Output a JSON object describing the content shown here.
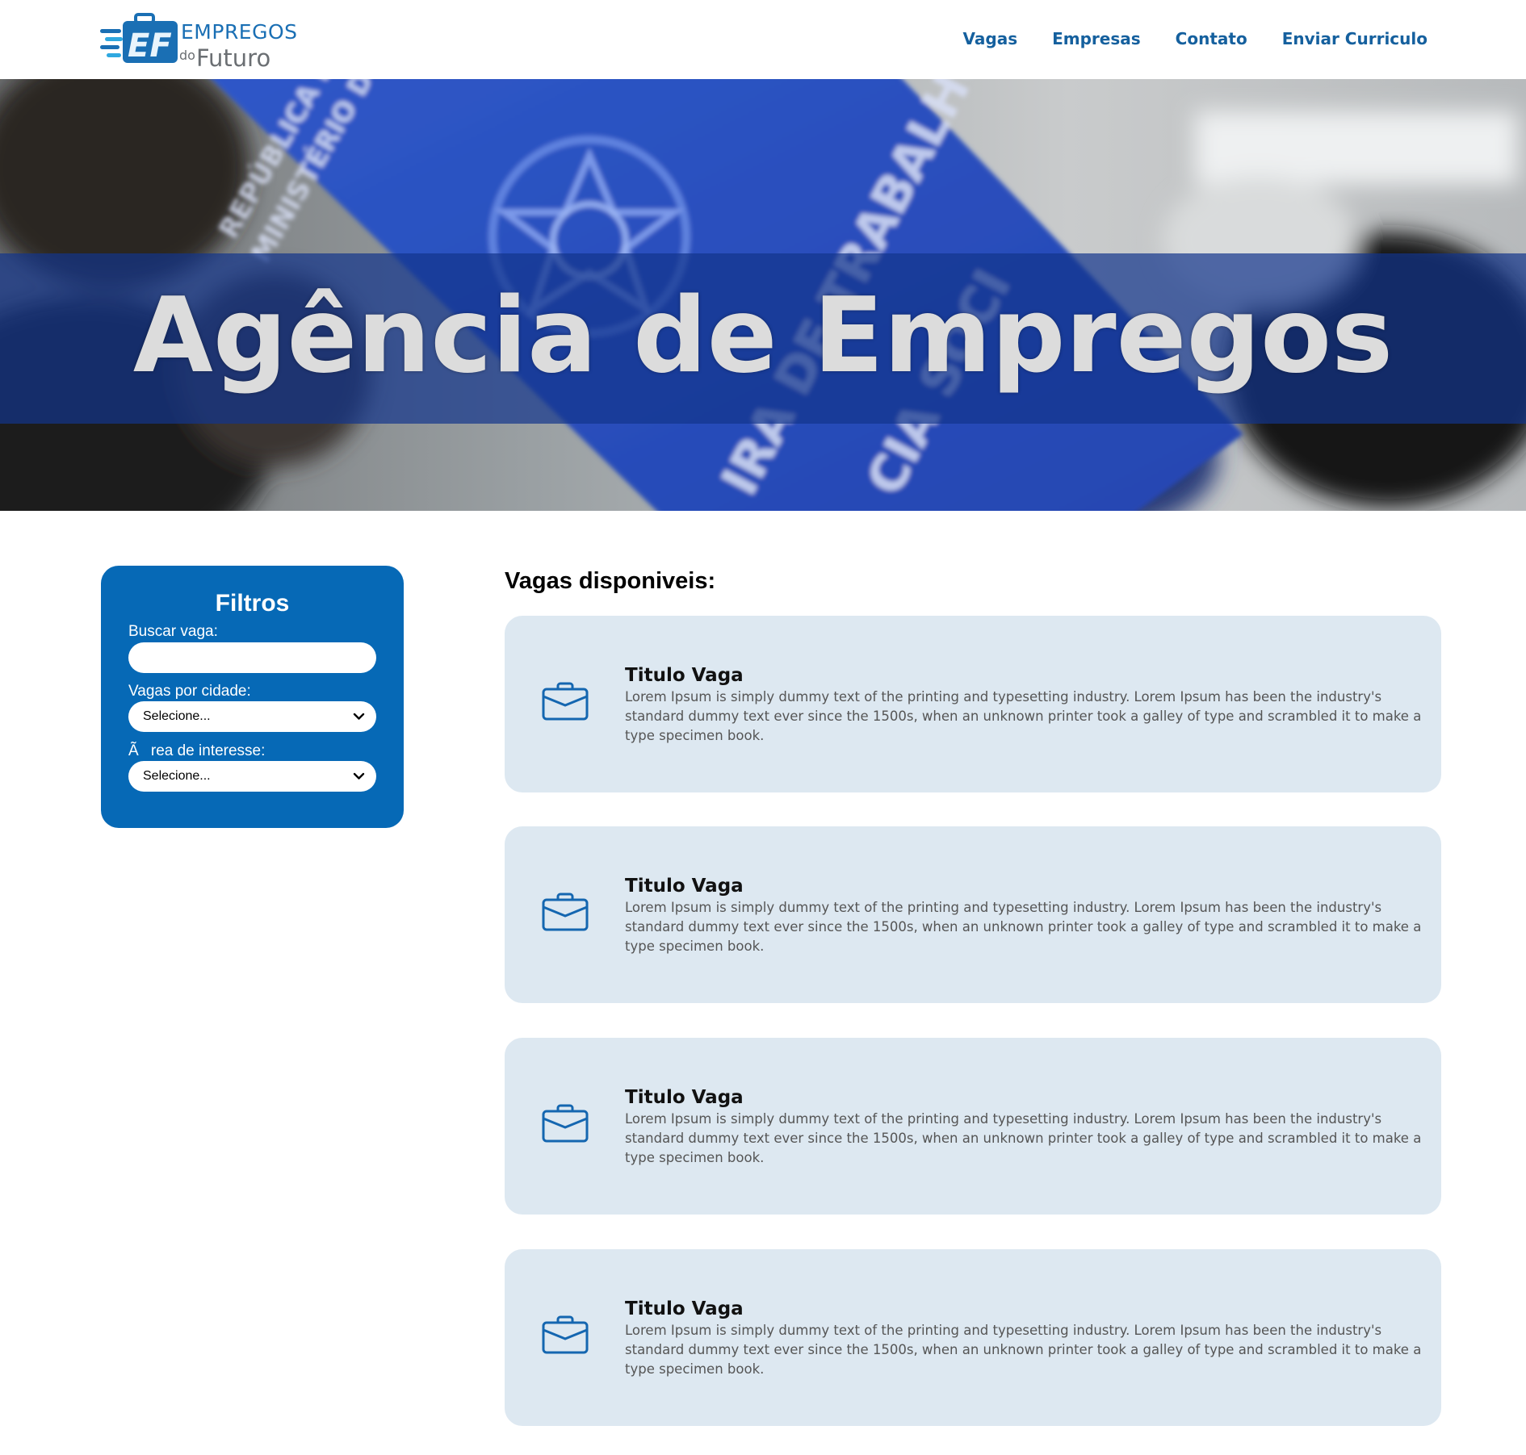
{
  "brand": {
    "logo_mark": "EF",
    "word1": "EMPREGOS",
    "word2_small": "do",
    "word2": "Futuro"
  },
  "nav": [
    "Vagas",
    "Empresas",
    "Contato",
    "Enviar Curriculo"
  ],
  "hero": {
    "title": "Agência de Empregos"
  },
  "filters": {
    "title": "Filtros",
    "search_label": "Buscar vaga:",
    "search_value": "",
    "city_label": "Vagas por cidade:",
    "city_selected": "Selecione...",
    "area_label": "Ãrea de interesse:",
    "area_selected": "Selecione..."
  },
  "jobs_heading": "Vagas disponiveis:",
  "jobs": [
    {
      "icon": "briefcase-icon",
      "title": "Titulo Vaga",
      "description": "Lorem Ipsum is simply dummy text of the printing and typesetting industry. Lorem Ipsum has been the industry's standard dummy text ever since the 1500s, when an unknown printer took a galley of type and scrambled it to make a type specimen book."
    },
    {
      "icon": "briefcase-icon",
      "title": "Titulo Vaga",
      "description": "Lorem Ipsum is simply dummy text of the printing and typesetting industry. Lorem Ipsum has been the industry's standard dummy text ever since the 1500s, when an unknown printer took a galley of type and scrambled it to make a type specimen book."
    },
    {
      "icon": "briefcase-icon",
      "title": "Titulo Vaga",
      "description": "Lorem Ipsum is simply dummy text of the printing and typesetting industry. Lorem Ipsum has been the industry's standard dummy text ever since the 1500s, when an unknown printer took a galley of type and scrambled it to make a type specimen book."
    },
    {
      "icon": "briefcase-icon",
      "title": "Titulo Vaga",
      "description": "Lorem Ipsum is simply dummy text of the printing and typesetting industry. Lorem Ipsum has been the industry's standard dummy text ever since the 1500s, when an unknown printer took a galley of type and scrambled it to make a type specimen book."
    }
  ],
  "colors": {
    "brand_blue": "#0669b6",
    "nav_blue": "#15609e",
    "card_bg": "#dde8f1",
    "hero_band": "#12348c"
  }
}
